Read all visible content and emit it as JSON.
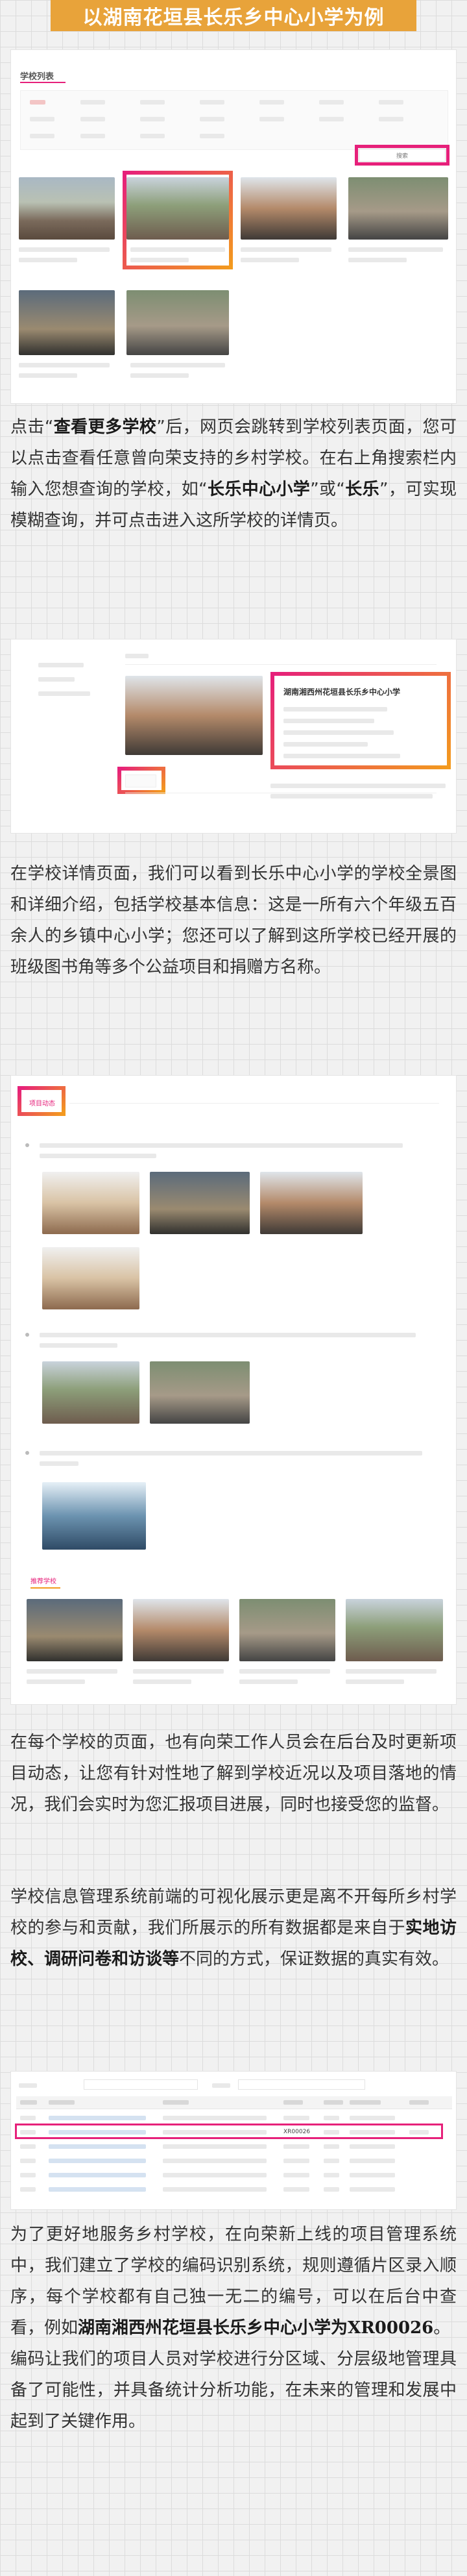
{
  "headline": "以湖南花垣县长乐乡中心小学为例",
  "placeholder": "▇▇▇",
  "screenshot1": {
    "panel_title": "学校列表",
    "search_button": "搜索"
  },
  "para1": {
    "s1": "点击“",
    "s1b": "查看更多学校",
    "s2": "”后，网页会跳转到学校列表页面，您可以点击查看任意曾向荣支持的乡村学校。在右上角搜索栏内输入您想查询的学校，如“",
    "s2b": "长乐中心小学",
    "s3": "”或“",
    "s3b": "长乐",
    "s4": "”，可实现模糊查询，并可点击进入这所学校的详情页。"
  },
  "screenshot2": {
    "school_name": "湖南湘西州花垣县长乐乡中心小学"
  },
  "para2": {
    "text": "在学校详情页面，我们可以看到长乐中心小学的学校全景图和详细介绍，包括学校基本信息：这是一所有六个年级五百余人的乡镇中心小学；您还可以了解到这所学校已经开展的班级图书角等多个公益项目和捐赠方名称。"
  },
  "screenshot3": {
    "section_label": "项目动态",
    "recommend_label": "推荐学校"
  },
  "para3": {
    "text": "在每个学校的页面，也有向荣工作人员会在后台及时更新项目动态，让您有针对性地了解到学校近况以及项目落地的情况，我们会实时为您汇报项目进展，同时也接受您的监督。"
  },
  "para4": {
    "s1": "学校信息管理系统前端的可视化展示更是离不开每所乡村学校的参与和贡献，我们所展示的所有数据都是来自于",
    "s1b": "实地访校、调研问卷和访谈等",
    "s2": "不同的方式，保证数据的真实有效。"
  },
  "screenshot4": {
    "code": "XR00026"
  },
  "para5": {
    "s1": "为了更好地服务乡村学校，在向荣新上线的项目管理系统中，我们建立了学校的编码识别系统，规则遵循片区录入顺序，每个学校都有自己独一无二的编号，可以在后台中查看，例如",
    "s1b": "湖南湘西州花垣县长乐乡中心小学为",
    "s1c": "XR00026",
    "s2": "。",
    "s3": "编码让我们的项目人员对学校进行分区域、分层级地管理具备了可能性，并具备统计分析功能，在未来的管理和发展中起到了关键作用。"
  },
  "colors": {
    "headline_bg": "#e8a33a",
    "highlight_pink": "#e6207a",
    "highlight_orange": "#f39a1e",
    "link_blue": "#3a6fb0"
  }
}
